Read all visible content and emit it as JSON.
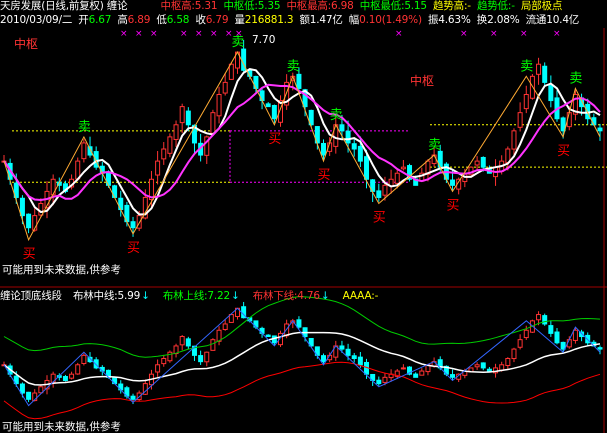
{
  "header": {
    "title": "天房发展(日线,前复权) 缠论",
    "zs_high_label": "中枢高:",
    "zs_high": "5.31",
    "zs_low_label": "中枢低:",
    "zs_low": "5.35",
    "zs_max_label": "中枢最高:",
    "zs_max": "6.98",
    "zs_min_label": "中枢最低:",
    "zs_min": "5.15",
    "trend_high_label": "趋势高:-",
    "trend_low_label": "趋势低:-",
    "local_label": "局部极点"
  },
  "quote": {
    "date": "2010/03/09/二",
    "open_label": "开",
    "open": "6.67",
    "high_label": "高",
    "high": "6.89",
    "low_label": "低",
    "low": "6.58",
    "close_label": "收",
    "close": "6.79",
    "vol_label": "量",
    "vol": "216881.3",
    "amt_label": "额",
    "amt": "1.47亿",
    "chg_label": "幅",
    "chg": "0.10(1.49%)",
    "amp_label": "振",
    "amp": "4.63%",
    "turn_label": "换",
    "turn": "2.08%",
    "float_label": "流通",
    "float": "10.4亿"
  },
  "upper": {
    "peak_value": "7.70",
    "zs_tag": "中枢",
    "buy_label": "买",
    "sell_label": "卖",
    "note": "可能用到未来数据,供参考"
  },
  "lower": {
    "title": "缠论顶底线段",
    "mid_label": "布林中线:",
    "mid": "5.99",
    "up_label": "布林上线:",
    "up": "7.22",
    "dn_label": "布林下线:",
    "dn": "4.76",
    "aaaa_label": "AAAA:-",
    "note": "可能用到未来数据,供参考"
  },
  "colors": {
    "up": "#ff3333",
    "down": "#00ffff",
    "text": "#ffffff",
    "yellow": "#ffff00",
    "green": "#00ff00",
    "magenta": "#ff00ff",
    "red": "#ff0000",
    "border": "#a00000"
  },
  "chart_data": {
    "type": "candlestick",
    "closes": [
      5.9,
      5.6,
      5.3,
      5.0,
      4.8,
      5.0,
      5.2,
      5.4,
      5.6,
      5.5,
      5.4,
      5.6,
      5.9,
      6.2,
      6.0,
      5.8,
      5.7,
      5.5,
      5.3,
      5.1,
      4.9,
      4.8,
      5.0,
      5.3,
      5.6,
      5.9,
      6.1,
      6.3,
      6.5,
      6.8,
      6.5,
      6.2,
      6.0,
      6.3,
      6.7,
      7.0,
      7.2,
      7.5,
      7.7,
      7.4,
      7.3,
      7.1,
      6.9,
      6.8,
      6.6,
      6.9,
      7.2,
      7.3,
      7.1,
      6.8,
      6.5,
      6.2,
      6.0,
      6.2,
      6.5,
      6.4,
      6.2,
      6.1,
      5.9,
      5.6,
      5.4,
      5.3,
      5.5,
      5.6,
      5.7,
      5.8,
      5.6,
      5.5,
      5.7,
      5.9,
      6.0,
      5.8,
      5.6,
      5.5,
      5.6,
      5.7,
      5.8,
      5.9,
      5.8,
      5.7,
      5.8,
      5.9,
      6.1,
      6.4,
      6.7,
      7.0,
      7.3,
      7.5,
      7.2,
      6.9,
      6.6,
      6.4,
      6.7,
      7.0,
      6.8,
      6.6,
      6.5,
      6.4
    ],
    "peak": 7.7,
    "bollinger": {
      "mid": 5.99,
      "upper": 7.22,
      "lower": 4.76
    }
  }
}
